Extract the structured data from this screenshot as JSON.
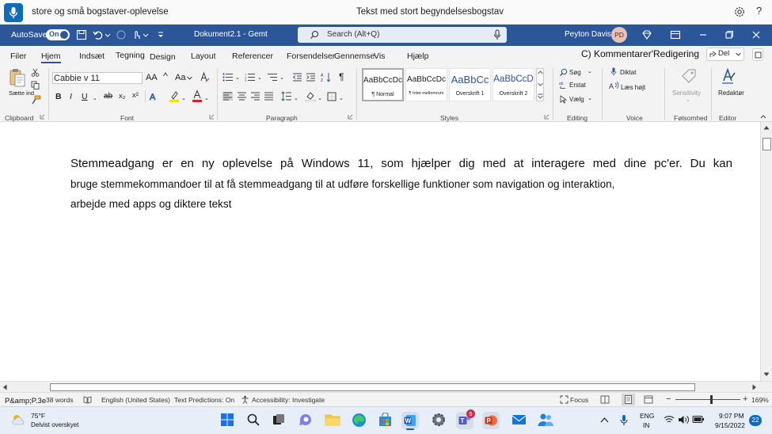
{
  "voice_bar": {
    "text": "store og små bogstaver-oplevelse",
    "title": "Tekst med stort begyndelsesbogstav",
    "help": "?"
  },
  "titlebar": {
    "autosave": "AutoSave",
    "toggle": "On",
    "doc": "Dokument2.1 - Gemt",
    "search": "Search (Alt+Q)",
    "user": "Peyton Davis",
    "initials": "PD"
  },
  "menu": [
    "Filer",
    "Hjem",
    "Indsæt",
    "Tegning",
    "Design",
    "Layout",
    "Referencer",
    "Forsendelser",
    "Gennemse",
    "Vis",
    "Hjælp"
  ],
  "comments": "C) Kommentarer'Redigering",
  "share": "Del",
  "ribbon": {
    "clipboard": {
      "paste": "Sætte ind",
      "label": "Clipboard"
    },
    "font": {
      "name": "Cabbie v 11",
      "grow": "AA",
      "case": "Aa",
      "label": "Font"
    },
    "paragraph": {
      "label": "Paragraph"
    },
    "styles": {
      "label": "Styles",
      "items": [
        {
          "preview": "AaBbCcDc",
          "name": "¶ Normal"
        },
        {
          "preview": "AaBbCcDc",
          "name": "¶ Intet mellemrum"
        },
        {
          "preview": "AaBbCc",
          "name": "Overskrift 1"
        },
        {
          "preview": "AaBbCcD",
          "name": "Overskrift 2"
        }
      ]
    },
    "editing": {
      "find": "Søg",
      "replace": "Erstat",
      "select": "Vælg",
      "label": "Editing"
    },
    "voice": {
      "dictate": "Diktat",
      "read": "Læs højt",
      "label": "Voice"
    },
    "sensitivity": {
      "name": "Sensitivity",
      "label": "Følsomhed"
    },
    "editor": {
      "name": "Redaktør",
      "label": "Editor"
    }
  },
  "document": {
    "line1": "Stemmeadgang er en ny oplevelse på Windows 11, som hjælper dig med at interagere med dine pc'er. Du kan",
    "line2": "bruge stemmekommandoer til at få stemmeadgang til at udføre forskellige funktioner som navigation og interaktion,",
    "line3": "arbejde med apps og diktere tekst"
  },
  "status": {
    "page": "P&amp;P.3e",
    "words": "38 words",
    "lang": "English (United States)",
    "predictions": "Text Predictions: On",
    "accessibility": "Accessibility: Investigate",
    "focus": "Focus",
    "zoom": "169%"
  },
  "taskbar": {
    "temp": "75°F",
    "weather": "Delvist overskyet",
    "lang1": "ENG",
    "lang2": "IN",
    "time": "9:07 PM",
    "date": "9/15/2022",
    "notif": "22",
    "teams_badge": "5"
  }
}
